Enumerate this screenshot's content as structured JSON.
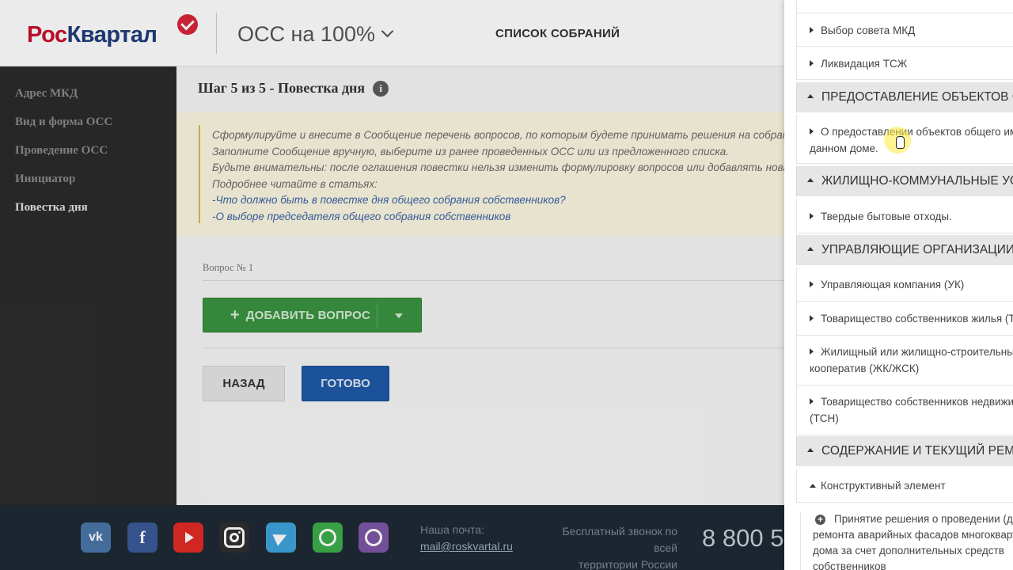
{
  "header": {
    "logo_part1": "Рос",
    "logo_part2": "Квартал",
    "product_title": "ОСС на 100%",
    "nav_meetings": "СПИСОК СОБРАНИЙ"
  },
  "sidebar": {
    "items": [
      {
        "label": "Адрес МКД"
      },
      {
        "label": "Вид и форма ОСС"
      },
      {
        "label": "Проведение ОСС"
      },
      {
        "label": "Инициатор"
      },
      {
        "label": "Повестка дня"
      }
    ],
    "active_index": 4
  },
  "main": {
    "step_title": "Шаг 5 из 5 - Повестка дня",
    "notice": {
      "lines": [
        "Сформулируйте и внесите в Сообщение перечень вопросов, по которым будете принимать решения на собрании.",
        "Заполните Сообщение вручную, выберите из ранее проведенных ОСС или из предложенного списка.",
        "Будьте внимательны: после оглашения повестки нельзя изменить формулировку вопросов или добавлять новые (ч",
        "Подробнее читайте в статьях:"
      ],
      "links": [
        "-Что должно быть в повестке дня общего собрания собственников?",
        "-О выборе председателя общего собрания собственников"
      ]
    },
    "question_label": "Вопрос № 1",
    "add_question_label": "ДОБАВИТЬ ВОПРОС",
    "back_label": "НАЗАД",
    "done_label": "ГОТОВО"
  },
  "footer": {
    "mail_label": "Наша почта:",
    "mail": "mail@roskvartal.ru",
    "free_call_line1": "Бесплатный звонок по всей",
    "free_call_line2": "территории России",
    "phone": "8 800 5"
  },
  "panel": {
    "rows": [
      {
        "label": "Выбор совета МКД"
      },
      {
        "label": "Ликвидация ТСЖ"
      }
    ],
    "sections": [
      {
        "title": "ПРЕДОСТАВЛЕНИЕ ОБЪЕКТОВ ОБ",
        "items": [
          {
            "line1": "О предоставлении объектов общего им",
            "line2": "данном доме."
          }
        ]
      },
      {
        "title": "ЖИЛИЩНО-КОММУНАЛЬНЫЕ УСЛ",
        "items": [
          {
            "line1": "Твердые бытовые отходы."
          }
        ]
      },
      {
        "title": "УПРАВЛЯЮЩИЕ ОРГАНИЗАЦИИ",
        "items": [
          {
            "line1": "Управляющая компания (УК)"
          },
          {
            "line1": "Товарищество собственников жилья (Т"
          },
          {
            "line1": "Жилищный или жилищно-строительный",
            "line2": "кооператив (ЖК/ЖСК)"
          },
          {
            "line1": "Товарищество собственников недвижи",
            "line2": "(ТСН)"
          }
        ]
      },
      {
        "title": "СОДЕРЖАНИЕ И ТЕКУЩИЙ РЕМО",
        "items": [
          {
            "line1": "Конструктивный элемент"
          }
        ]
      }
    ],
    "expanded_item": {
      "line1": "Принятие решения о проведении (д",
      "line2": "ремонта аварийных фасадов многокварт",
      "line3": "дома за счет дополнительных средств",
      "line4": "собственников"
    }
  }
}
